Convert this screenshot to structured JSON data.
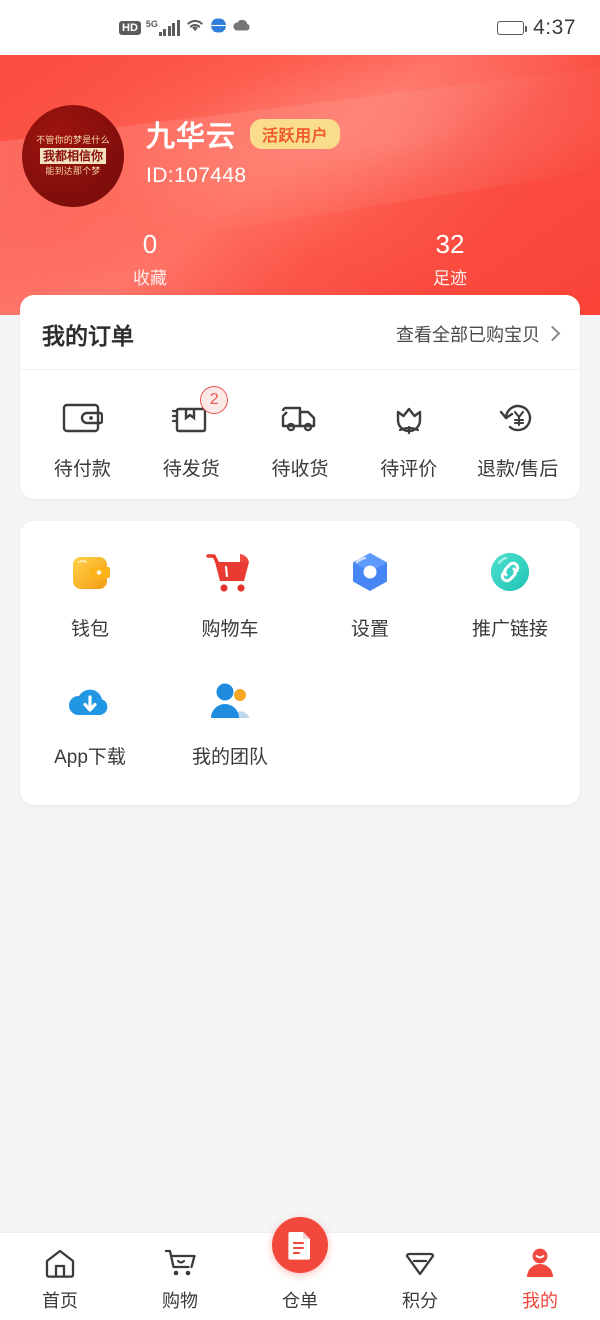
{
  "status_bar": {
    "hd_label": "HD",
    "network_label": "5G",
    "icons": [
      "hd-icon",
      "signal-icon",
      "wifi-icon",
      "globe-icon",
      "cloud-icon",
      "battery-icon"
    ],
    "time": "4:37"
  },
  "profile": {
    "avatar": {
      "line1": "不管你的梦是什么",
      "line2": "我都相信你",
      "line3": "能到达那个梦"
    },
    "username": "九华云",
    "badge": "活跃用户",
    "user_id": "ID:107448",
    "stats": [
      {
        "value": "0",
        "label": "收藏"
      },
      {
        "value": "32",
        "label": "足迹"
      }
    ],
    "accent_color": "#fa4b40",
    "badge_bg": "#f9dd8d",
    "badge_color": "#f05a2a"
  },
  "orders": {
    "title": "我的订单",
    "view_all": "查看全部已购宝贝",
    "items": [
      {
        "label": "待付款",
        "icon": "wallet-outline-icon",
        "badge": ""
      },
      {
        "label": "待发货",
        "icon": "package-outline-icon",
        "badge": "2"
      },
      {
        "label": "待收货",
        "icon": "truck-outline-icon",
        "badge": ""
      },
      {
        "label": "待评价",
        "icon": "flower-outline-icon",
        "badge": ""
      },
      {
        "label": "退款/售后",
        "icon": "refund-yen-icon",
        "badge": ""
      }
    ]
  },
  "tools": {
    "items": [
      {
        "label": "钱包",
        "icon": "wallet-icon",
        "color": "#f7b500"
      },
      {
        "label": "购物车",
        "icon": "shopping-cart-icon",
        "color": "#ec3b3b"
      },
      {
        "label": "设置",
        "icon": "settings-hex-icon",
        "color": "#4a86f7"
      },
      {
        "label": "推广链接",
        "icon": "link-icon",
        "color": "#2dd4c4"
      },
      {
        "label": "App下载",
        "icon": "cloud-download-icon",
        "color": "#2196e3"
      },
      {
        "label": "我的团队",
        "icon": "team-icon",
        "color": "#1f8ce0"
      }
    ]
  },
  "tabbar": {
    "items": [
      {
        "label": "首页",
        "icon": "home-icon",
        "active": false
      },
      {
        "label": "购物",
        "icon": "cart-icon",
        "active": false
      },
      {
        "label": "仓单",
        "icon": "document-icon",
        "active": false,
        "center": true
      },
      {
        "label": "积分",
        "icon": "diamond-icon",
        "active": false
      },
      {
        "label": "我的",
        "icon": "person-icon",
        "active": true
      }
    ],
    "active_color": "#f1483d"
  }
}
